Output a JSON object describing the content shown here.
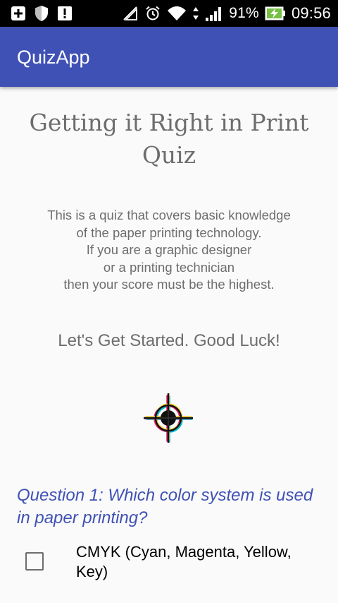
{
  "status_bar": {
    "battery_percent": "91%",
    "time": "09:56",
    "left_icons": [
      "add-box-icon",
      "shield-icon",
      "alert-box-icon"
    ],
    "right_icons": [
      "no-signal-icon",
      "alarm-icon",
      "wifi-icon",
      "data-arrows-icon",
      "cell-signal-icon",
      "battery-charging-icon"
    ]
  },
  "app_bar": {
    "title": "QuizApp",
    "color": "#3f51b5"
  },
  "quiz": {
    "title": "Getting it Right in Print Quiz",
    "description": "This is a quiz that covers basic knowledge\nof the paper printing technology.\nIf you are a graphic designer\nor a printing technician\nthen your score must be the highest.",
    "start_message": "Let's Get Started. Good Luck!",
    "image_icon": "registration-mark-icon"
  },
  "question1": {
    "text": "Question 1: Which color system is used in paper printing?",
    "options": [
      {
        "label": "CMYK (Cyan, Magenta, Yellow, Key)",
        "checked": false
      }
    ]
  }
}
